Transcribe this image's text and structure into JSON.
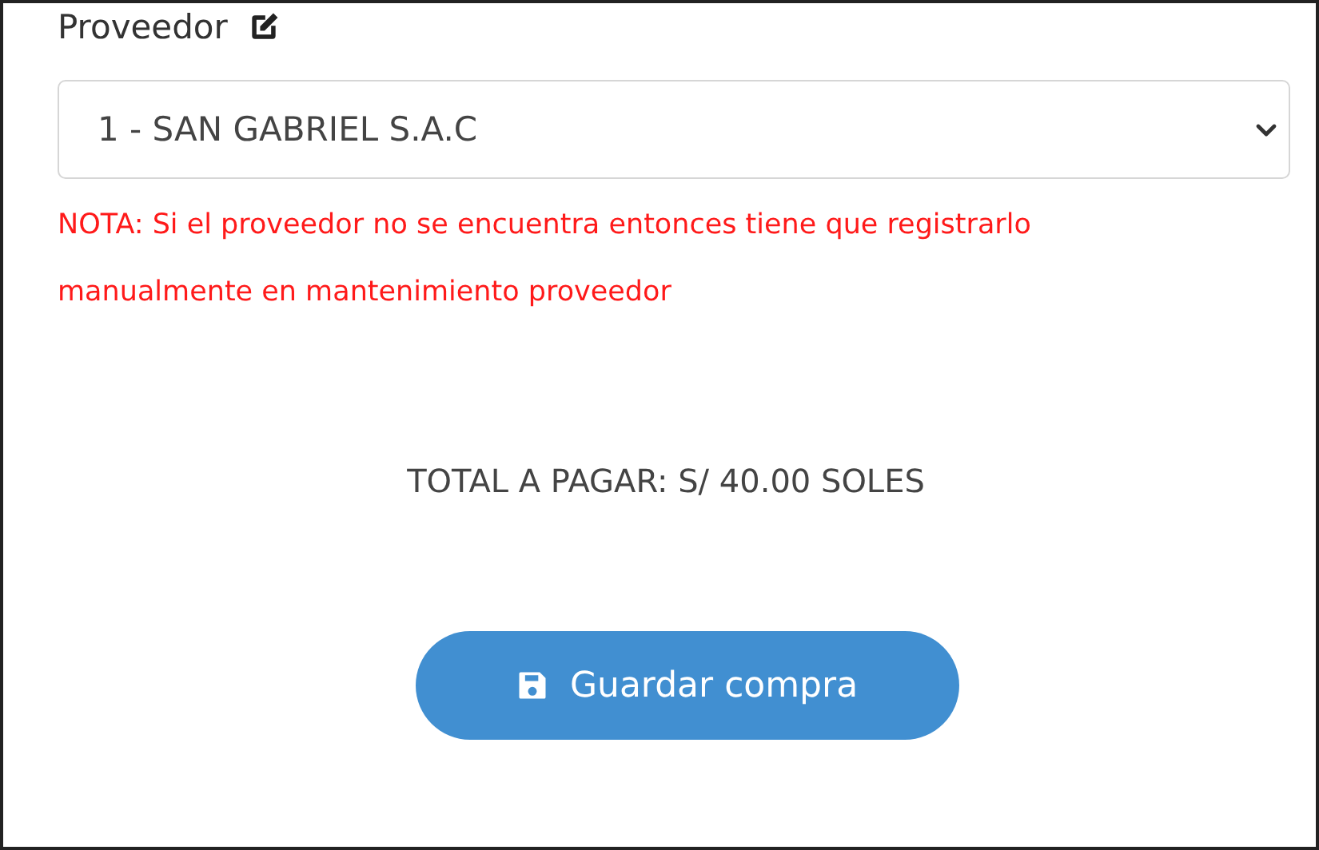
{
  "supplier_field": {
    "label": "Proveedor",
    "value": "1 - SAN GABRIEL S.A.C"
  },
  "note": "NOTA: Si el proveedor no se encuentra entonces tiene que registrarlo manualmente en mantenimiento proveedor",
  "total": "TOTAL A PAGAR: S/ 40.00 SOLES",
  "save_button": {
    "label": "Guardar compra"
  }
}
